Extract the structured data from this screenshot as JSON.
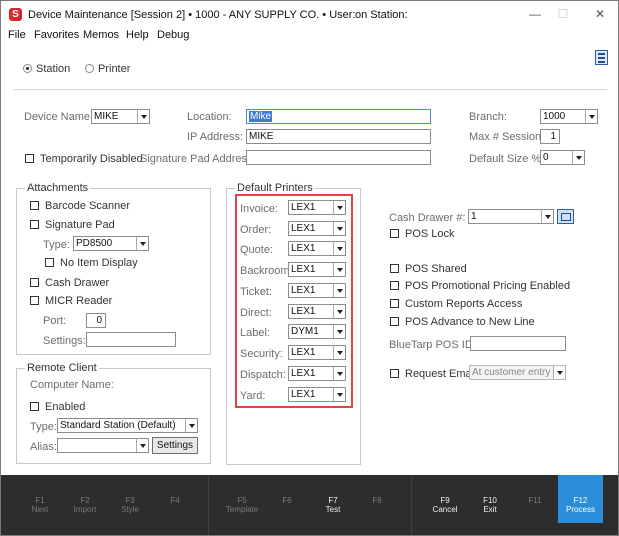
{
  "window": {
    "title": "Device Maintenance [Session 2]  •  1000 - ANY SUPPLY CO.  •  User:",
    "station_suffix": "on Station:",
    "icon_letter": "S",
    "minimize_glyph": "—",
    "maximize_glyph": "☐",
    "close_glyph": "✕"
  },
  "menu": [
    "File",
    "Favorites",
    "Memos",
    "Help",
    "Debug"
  ],
  "mode": {
    "station_label": "Station",
    "printer_label": "Printer",
    "selected": "Station"
  },
  "device": {
    "device_name_label": "Device Name:",
    "device_name_value": "MIKE",
    "temporarily_disabled_label": "Temporarily Disabled",
    "location_label": "Location:",
    "location_value": "Mike",
    "ip_label": "IP Address:",
    "ip_value": "MIKE",
    "sigpad_label": "Signature Pad Address:",
    "sigpad_value": "",
    "branch_label": "Branch:",
    "branch_value": "1000",
    "max_sessions_label": "Max # Sessions:",
    "max_sessions_value": "1",
    "default_size_label": "Default Size %:",
    "default_size_value": "0"
  },
  "attachments": {
    "title": "Attachments",
    "barcode_scanner": "Barcode Scanner",
    "signature_pad": "Signature Pad",
    "type_label": "Type:",
    "type_value": "PD8500",
    "no_item_display": "No Item Display",
    "cash_drawer": "Cash Drawer",
    "micr_reader": "MICR Reader",
    "port_label": "Port:",
    "port_value": "0",
    "settings_label": "Settings:",
    "settings_value": ""
  },
  "remote_client": {
    "title": "Remote Client",
    "computer_name_label": "Computer Name:",
    "enabled": "Enabled",
    "type_label": "Type:",
    "type_value": "Standard Station (Default)",
    "alias_label": "Alias:",
    "alias_value": "",
    "settings_button": "Settings"
  },
  "default_printers": {
    "title": "Default Printers",
    "rows": [
      {
        "label": "Invoice:",
        "value": "LEX1"
      },
      {
        "label": "Order:",
        "value": "LEX1"
      },
      {
        "label": "Quote:",
        "value": "LEX1"
      },
      {
        "label": "Backroom:",
        "value": "LEX1"
      },
      {
        "label": "Ticket:",
        "value": "LEX1"
      },
      {
        "label": "Direct:",
        "value": "LEX1"
      },
      {
        "label": "Label:",
        "value": "DYM1"
      },
      {
        "label": "Security:",
        "value": "LEX1"
      },
      {
        "label": "Dispatch:",
        "value": "LEX1"
      },
      {
        "label": "Yard:",
        "value": "LEX1"
      }
    ]
  },
  "pos": {
    "cash_drawer_label": "Cash Drawer #:",
    "cash_drawer_value": "1",
    "pos_lock": "POS Lock",
    "pos_shared": "POS Shared",
    "pos_promo": "POS Promotional Pricing Enabled",
    "custom_reports": "Custom Reports Access",
    "pos_advance": "POS Advance to New Line",
    "bluetarp_label": "BlueTarp POS ID:",
    "bluetarp_value": "",
    "request_email": "Request Email",
    "request_email_value": "At customer entry"
  },
  "fkeys": [
    {
      "key": "F1",
      "label": "Next"
    },
    {
      "key": "F2",
      "label": "Import"
    },
    {
      "key": "F3",
      "label": "Style"
    },
    {
      "key": "F4",
      "label": ""
    },
    {
      "key": "F5",
      "label": "Template"
    },
    {
      "key": "F6",
      "label": ""
    },
    {
      "key": "F7",
      "label": "Test"
    },
    {
      "key": "F8",
      "label": ""
    },
    {
      "key": "F9",
      "label": "Cancel"
    },
    {
      "key": "F10",
      "label": "Exit"
    },
    {
      "key": "F11",
      "label": ""
    },
    {
      "key": "F12",
      "label": "Process"
    }
  ],
  "colors": {
    "accent": "#2a8fd8",
    "highlight_box": "#e0424a",
    "footer_bg": "#2d2d2d"
  }
}
